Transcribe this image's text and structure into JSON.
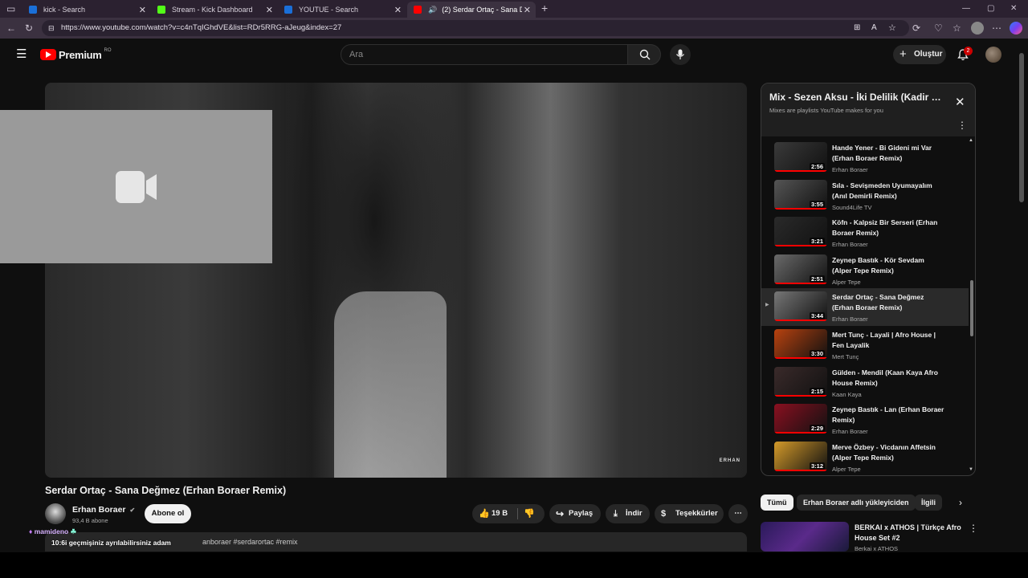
{
  "browser": {
    "tabs": [
      {
        "label": "kick - Search",
        "color": "#1a6fd8"
      },
      {
        "label": "Stream - Kick Dashboard",
        "color": "#53fc18"
      },
      {
        "label": "YOUTUE - Search",
        "color": "#1a6fd8"
      },
      {
        "label": "(2) Serdar Ortaç - Sana Değmez",
        "color": "#ff0000"
      }
    ],
    "url": "https://www.youtube.com/watch?v=c4nTqIGhdVE&list=RDr5RRG-aJeug&index=27"
  },
  "header": {
    "logo": "Premium",
    "region": "RO",
    "search_placeholder": "Ara",
    "create_label": "Oluştur",
    "notification_count": "2"
  },
  "video": {
    "title": "Serdar Ortaç - Sana Değmez (Erhan Boraer Remix)",
    "watermark": "ERHAN",
    "channel": "Erhan Boraer",
    "subscribers": "93,4 B abone",
    "subscribe_label": "Abone ol",
    "likes": "19 B",
    "share_label": "Paylaş",
    "download_label": "İndir",
    "thanks_label": "Teşekkürler",
    "description_fragment": "anboraer #serdarortac #remix"
  },
  "chat": {
    "user": "mamideno",
    "message": "10:6i geçmişiniz ayrılabilirsiniz adam"
  },
  "playlist": {
    "title": "Mix - Sezen Aksu - İki Delilik (Kadir Kaplan Remix)",
    "subtitle": "Mixes are playlists YouTube makes for you",
    "items": [
      {
        "title": "Hande Yener - Bi Gideni mi Var (Erhan Boraer Remix)",
        "channel": "Erhan Boraer",
        "duration": "2:56",
        "thumb": "#3a3a3a",
        "current": false
      },
      {
        "title": "Sıla - Sevişmeden Uyumayalım (Anıl Demirli Remix)",
        "channel": "Sound4Life TV",
        "duration": "3:55",
        "thumb": "#555555",
        "current": false
      },
      {
        "title": "Köfn - Kalpsiz Bir Serseri (Erhan Boraer Remix)",
        "channel": "Erhan Boraer",
        "duration": "3:21",
        "thumb": "#2a2a2a",
        "current": false
      },
      {
        "title": "Zeynep Bastık - Kör Sevdam (Alper Tepe Remix)",
        "channel": "Alper Tepe",
        "duration": "2:51",
        "thumb": "#6a6a6a",
        "current": false
      },
      {
        "title": "Serdar Ortaç - Sana Değmez (Erhan Boraer Remix)",
        "channel": "Erhan Boraer",
        "duration": "3:44",
        "thumb": "#777777",
        "current": true
      },
      {
        "title": "Mert Tunç - Layali | Afro House | Fen Layalik",
        "channel": "Mert Tunç",
        "duration": "3:30",
        "thumb": "#b8420f",
        "current": false
      },
      {
        "title": "Gülden - Mendil (Kaan Kaya Afro House Remix)",
        "channel": "Kaan Kaya",
        "duration": "2:15",
        "thumb": "#3a2a2a",
        "current": false
      },
      {
        "title": "Zeynep Bastık - Lan (Erhan Boraer Remix)",
        "channel": "Erhan Boraer",
        "duration": "2:29",
        "thumb": "#8a1020",
        "current": false
      },
      {
        "title": "Merve Özbey - Vicdanın Affetsin (Alper Tepe Remix)",
        "channel": "Alper Tepe",
        "duration": "3:12",
        "thumb": "#d49a2a",
        "current": false
      }
    ]
  },
  "chips": [
    "Tümü",
    "Erhan Boraer adlı yükleyiciden",
    "İlgili"
  ],
  "related": {
    "title": "BERKAI x ATHOS | Türkçe Afro House Set #2",
    "channel": "Berkai x ATHOS"
  }
}
